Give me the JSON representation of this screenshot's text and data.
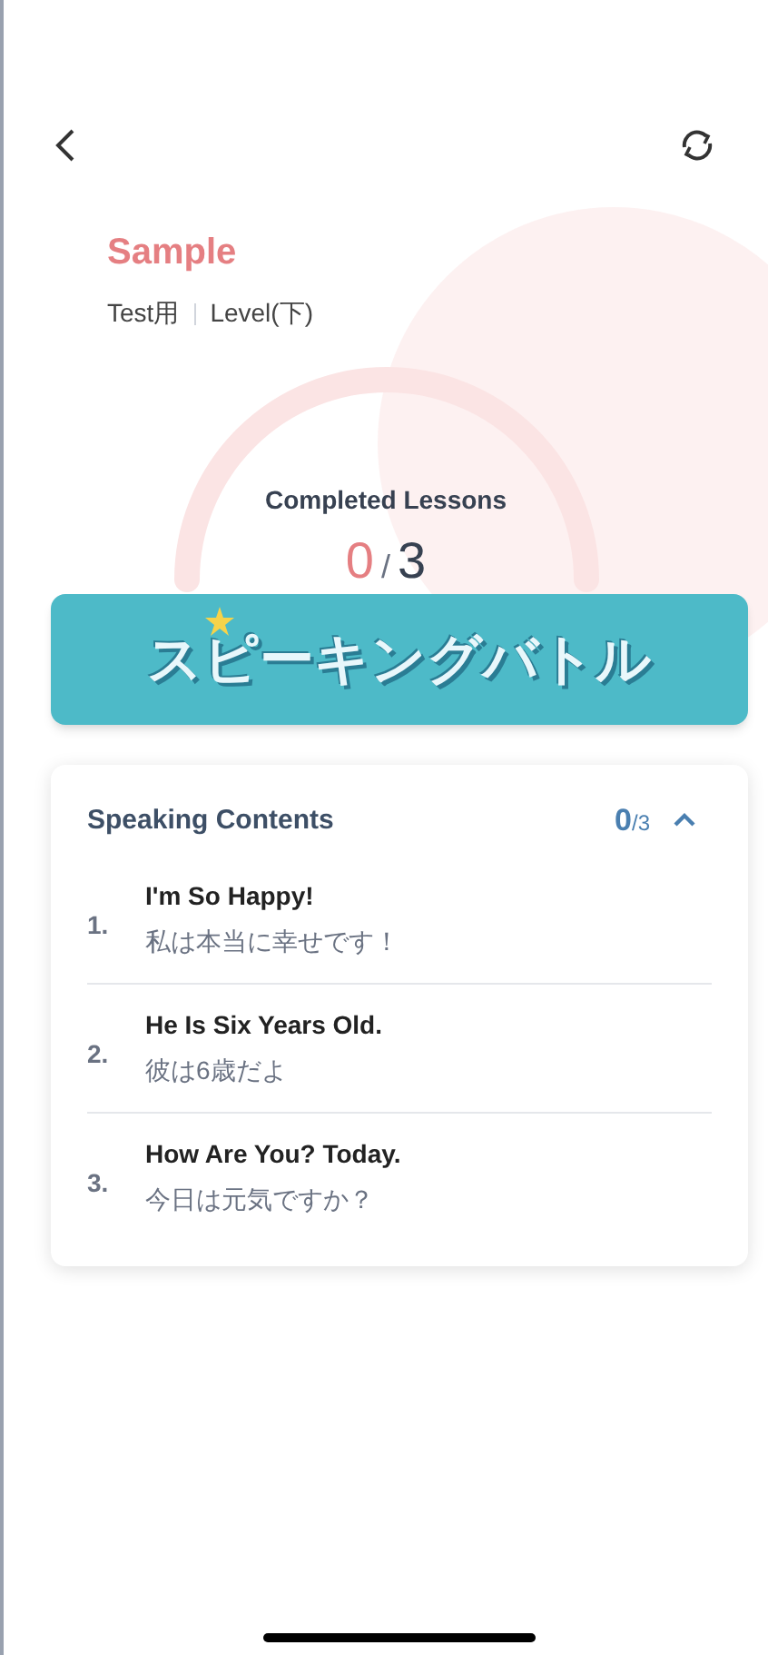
{
  "header": {
    "name": "Sample",
    "course": "Test用",
    "level": "Level(下)"
  },
  "progress": {
    "label": "Completed Lessons",
    "done": "0",
    "separator": "/",
    "total": "3"
  },
  "banner": {
    "title": "スピーキングバトル"
  },
  "contents": {
    "title": "Speaking Contents",
    "done": "0",
    "total": "/3",
    "expanded": true,
    "items": [
      {
        "number": "1.",
        "english": "I'm So Happy!",
        "japanese": "私は本当に幸せです！"
      },
      {
        "number": "2.",
        "english": "He Is Six Years Old.",
        "japanese": "彼は6歳だよ"
      },
      {
        "number": "3.",
        "english": "How Are You? Today.",
        "japanese": "今日は元気ですか？"
      }
    ]
  }
}
